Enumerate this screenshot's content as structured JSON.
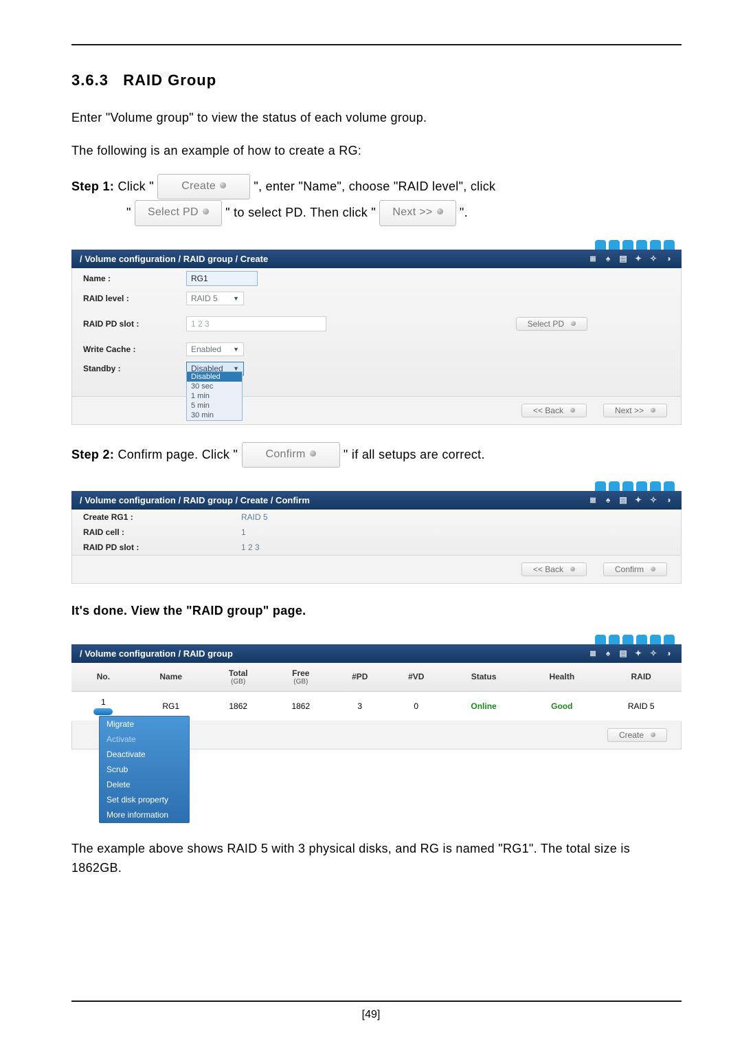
{
  "section": {
    "number": "3.6.3",
    "title": "RAID Group"
  },
  "intro1": "Enter \"Volume group\" to view the status of each volume group.",
  "intro2": "The following is an example of how to create a RG:",
  "step1": {
    "label": "Step 1:",
    "pre": "Click \"",
    "btn_create": "Create",
    "mid1": "\", enter \"Name\", choose \"RAID level\", click",
    "quote_open": "\"",
    "btn_selectpd": "Select PD",
    "mid2": "\" to select PD. Then click \"",
    "btn_next": "Next >>",
    "end": "\"."
  },
  "panel_create": {
    "breadcrumb": "/ Volume configuration / RAID group / Create",
    "name_label": "Name :",
    "name_value": "RG1",
    "raid_level_label": "RAID level :",
    "raid_level_value": "RAID 5",
    "pd_slot_label": "RAID PD slot :",
    "pd_slot_value": "1 2 3",
    "select_pd_btn": "Select PD",
    "write_cache_label": "Write Cache :",
    "write_cache_value": "Enabled",
    "standby_label": "Standby :",
    "standby_value": "Disabled",
    "standby_options": [
      "Disabled",
      "30 sec",
      "1 min",
      "5 min",
      "30 min"
    ],
    "back_btn": "<< Back",
    "next_btn": "Next >>"
  },
  "step2": {
    "label": "Step 2:",
    "pre": "Confirm page. Click \"",
    "btn_confirm": "Confirm",
    "post": "\" if all setups are correct."
  },
  "panel_confirm": {
    "breadcrumb": "/ Volume configuration / RAID group / Create / Confirm",
    "create_label": "Create RG1 :",
    "create_value": "RAID 5",
    "cell_label": "RAID cell :",
    "cell_value": "1",
    "pd_slot_label": "RAID PD slot :",
    "pd_slot_value": "1 2 3",
    "back_btn": "<< Back",
    "confirm_btn": "Confirm"
  },
  "done_text": "It's done.  View the \"RAID group\" page.",
  "panel_table": {
    "breadcrumb": "/ Volume configuration / RAID group",
    "headers": {
      "no": "No.",
      "name": "Name",
      "total": "Total",
      "total_sub": "(GB)",
      "free": "Free",
      "free_sub": "(GB)",
      "pd": "#PD",
      "vd": "#VD",
      "status": "Status",
      "health": "Health",
      "raid": "RAID"
    },
    "row": {
      "no": "1",
      "name": "RG1",
      "total": "1862",
      "free": "1862",
      "pd": "3",
      "vd": "0",
      "status": "Online",
      "health": "Good",
      "raid": "RAID 5"
    },
    "context_menu": [
      "Migrate",
      "Activate",
      "Deactivate",
      "Scrub",
      "Delete",
      "Set disk property",
      "More information"
    ],
    "create_btn": "Create"
  },
  "summary": "The example above shows RAID 5 with 3 physical disks, and RG is named \"RG1\". The total size is 1862GB.",
  "page_number": "[49]"
}
